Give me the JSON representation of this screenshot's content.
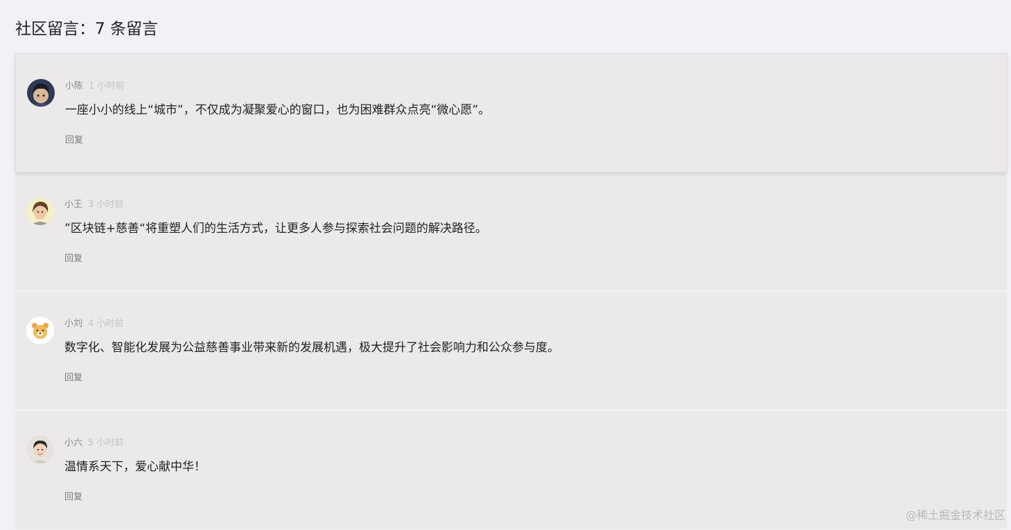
{
  "header": {
    "title": "社区留言：7 条留言"
  },
  "comments": [
    {
      "author": "小陈",
      "time": "1 小时前",
      "content": "一座小小的线上“城市”，不仅成为凝聚爱心的窗口，也为困难群众点亮“微心愿”。",
      "reply_label": "回复",
      "avatar_icon": "dark-hair-person-avatar"
    },
    {
      "author": "小王",
      "time": "3 小时前",
      "content": "”区块链+慈善“将重塑人们的生活方式，让更多人参与探索社会问题的解决路径。",
      "reply_label": "回复",
      "avatar_icon": "brown-hair-person-avatar"
    },
    {
      "author": "小刘",
      "time": "4 小时前",
      "content": "数字化、智能化发展为公益慈善事业带来新的发展机遇，极大提升了社会影响力和公众参与度。",
      "reply_label": "回复",
      "avatar_icon": "bear-avatar"
    },
    {
      "author": "小六",
      "time": "5 小时前",
      "content": "温情系天下，爱心献中华！",
      "reply_label": "回复",
      "avatar_icon": "man-portrait-avatar"
    }
  ],
  "watermark": "@稀土掘金技术社区"
}
